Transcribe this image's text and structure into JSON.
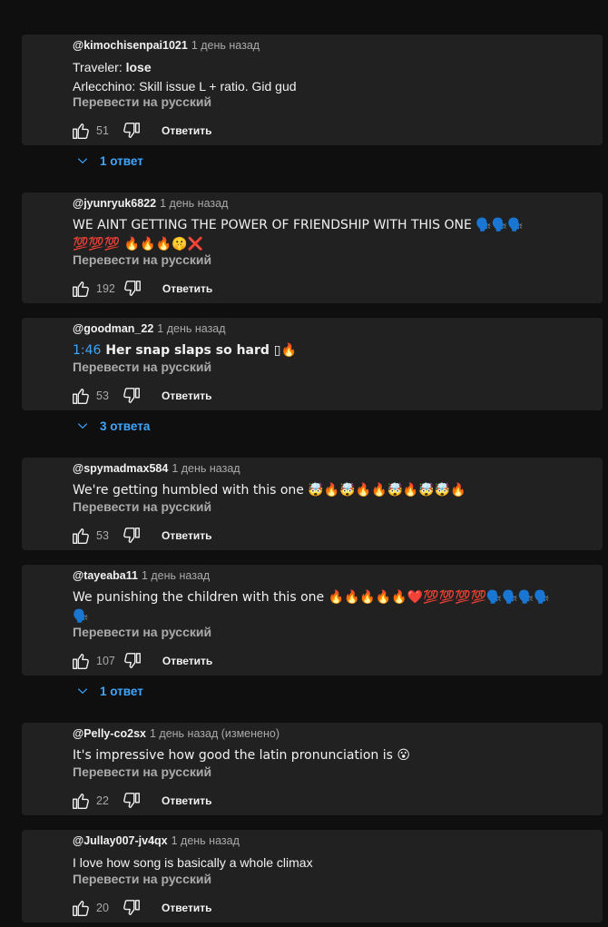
{
  "comments": [
    {
      "author": "@kimochisenpai1021",
      "time": "1 день назад",
      "line1_prefix": "Traveler: ",
      "line1_bold": "lose",
      "line2": "Arlecchino: Skill issue L + ratio. Gid gud",
      "translate": "Перевести на русский",
      "likes": "51",
      "reply": "Ответить",
      "replies": "1 ответ"
    },
    {
      "author": "@jyunryuk6822",
      "time": "1 день назад",
      "text": "WE AINT GETTING THE POWER OF FRIENDSHIP WITH THIS ONE 🗣️🗣️🗣️💯💯💯 🔥🔥🔥🤫❌",
      "translate": "Перевести на русский",
      "likes": "192",
      "reply": "Ответить"
    },
    {
      "author": "@goodman_22",
      "time": "1 день назад",
      "timestamp": "1:46",
      "text": " Her snap slaps so hard ▯🔥",
      "translate": "Перевести на русский",
      "likes": "53",
      "reply": "Ответить",
      "replies": "3 ответа"
    },
    {
      "author": "@spymadmax584",
      "time": "1 день назад",
      "text": "We're getting humbled with this one 🤯🔥🤯🔥🔥🤯🔥🤯🤯🔥",
      "translate": "Перевести на русский",
      "likes": "53",
      "reply": "Ответить"
    },
    {
      "author": "@tayeaba11",
      "time": "1 день назад",
      "text": "We punishing the children with this one 🔥🔥🔥🔥🔥❤️💯💯💯💯🗣️🗣️🗣️🗣️ 🗣️",
      "translate": "Перевести на русский",
      "likes": "107",
      "reply": "Ответить",
      "replies": "1 ответ"
    },
    {
      "author": "@Pelly-co2sx",
      "time": "1 день назад (изменено)",
      "text": "It's impressive how good the latin pronunciation is 😮",
      "translate": "Перевести на русский",
      "likes": "22",
      "reply": "Ответить"
    },
    {
      "author": "@Jullay007-jv4qx",
      "time": "1 день назад",
      "text": "I love how song is basically a whole climax",
      "translate": "Перевести на русский",
      "likes": "20",
      "reply": "Ответить"
    }
  ],
  "icons": {
    "like": "thumbs-up-icon",
    "dislike": "thumbs-down-icon",
    "expand": "chevron-down-icon"
  },
  "colors": {
    "background": "#0f0f0f",
    "card": "#212121",
    "link": "#3ea6ff",
    "secondary": "#aaaaaa"
  }
}
